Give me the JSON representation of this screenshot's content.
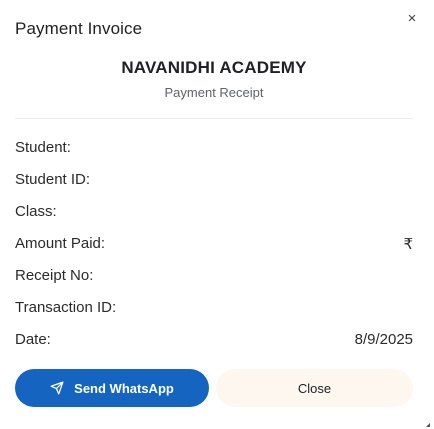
{
  "dialog": {
    "title": "Payment Invoice",
    "close_icon": "×"
  },
  "receipt": {
    "org_name": "NAVANIDHI ACADEMY",
    "subtitle": "Payment Receipt",
    "fields": [
      {
        "label": "Student:",
        "value": ""
      },
      {
        "label": "Student ID:",
        "value": ""
      },
      {
        "label": "Class:",
        "value": ""
      },
      {
        "label": "Amount Paid:",
        "value": "₹"
      },
      {
        "label": "Receipt No:",
        "value": ""
      },
      {
        "label": "Transaction ID:",
        "value": ""
      },
      {
        "label": "Date:",
        "value": "8/9/2025"
      }
    ]
  },
  "actions": {
    "send_label": "Send WhatsApp",
    "send_icon": "send-icon",
    "close_label": "Close"
  },
  "colors": {
    "primary": "#1565c0",
    "close_bg": "#fdf7f0"
  }
}
